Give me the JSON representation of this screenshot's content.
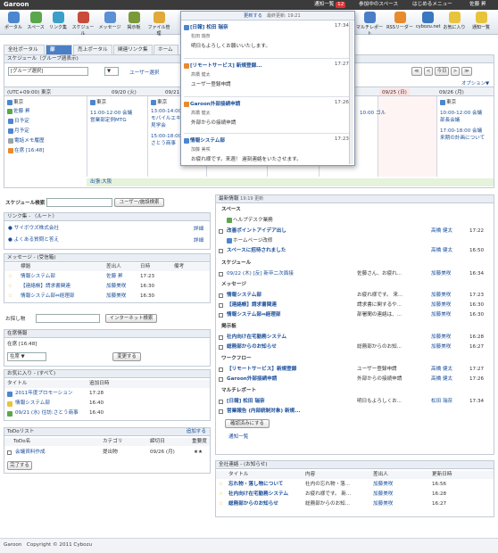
{
  "topbar": {
    "app_title": "Garoon",
    "notify_label": "通知一覧",
    "notify_count": "12",
    "space_label": "参加中のスペース",
    "beginner_menu": "はじめるメニュー",
    "user_name": "佐藤 昇"
  },
  "apps": [
    {
      "label": "ポータル",
      "icon": "portal-icon",
      "color": "#4c86cf"
    },
    {
      "label": "スペース",
      "icon": "space-icon",
      "color": "#5aa64c"
    },
    {
      "label": "リンク集",
      "icon": "link-icon",
      "color": "#3aa0c8"
    },
    {
      "label": "スケジュール",
      "icon": "calendar-icon",
      "color": "#c94b3b"
    },
    {
      "label": "メッセージ",
      "icon": "message-icon",
      "color": "#5b8fd6"
    },
    {
      "label": "掲示板",
      "icon": "bulletin-icon",
      "color": "#7a9a3a"
    },
    {
      "label": "ファイル管理",
      "icon": "folder-icon",
      "color": "#e0a93a"
    },
    {
      "label": "マルチレポート",
      "icon": "report-icon",
      "color": "#4a7fc6"
    },
    {
      "label": "RSSリーダー",
      "icon": "rss-icon",
      "color": "#e88b2c"
    },
    {
      "label": "cybozu.net",
      "icon": "cybozu-icon",
      "color": "#3a78c0"
    },
    {
      "label": "お気に入り",
      "icon": "star-icon",
      "color": "#e8c43c"
    },
    {
      "label": "通知一覧",
      "icon": "bell-icon",
      "color": "#e8c43c"
    }
  ],
  "tabs": [
    "全社ポータル",
    "部",
    "売上ポータル",
    "関連リンク集",
    "ホーム"
  ],
  "schedule": {
    "section_title": "スケジュール（グループ週表示)",
    "group_select": "[グループ選択]",
    "user_select": "ユーザー選択",
    "nav_today": "今日",
    "options": "オプション▼",
    "timezone": "(UTC+09:00) 東京",
    "days": [
      "09/20 (火)",
      "09/21 (水)",
      "",
      "",
      "",
      "09/25 (日)",
      "09/26 (月)"
    ],
    "location": "東京",
    "user_name": "佐藤 昇",
    "links": [
      "日予定",
      "月予定",
      "電話メモ履歴"
    ],
    "status": "在席 [16:48]",
    "events_tue": [
      "11:00-12:00 会議",
      "営業部定例MTG"
    ],
    "events_wed": [
      "13:00-14:00",
      "モバイルエキスポ",
      "見学会",
      "15:00-18:00",
      "さとう商事"
    ],
    "event_fri": "10:00 ゴル",
    "events_mon": [
      "10:00-12:00 会議",
      "部長会議",
      "17:00-18:00 会議",
      "来期の計画について"
    ],
    "trip": "出張:大阪"
  },
  "notify_popup": {
    "header": "更新する",
    "last_updated": "最終更新: 19:21",
    "items": [
      {
        "title": "[日報] 松田 瑞奈",
        "time": "17:34",
        "from": "松田 瑞奈",
        "body": "明日もよろしくお願いいたします。"
      },
      {
        "title": "[リモートサービス] 新規登録...",
        "time": "17:27",
        "from": "高橋 健太",
        "body": "ユーザー登録申請"
      },
      {
        "title": "Garoon外部接続申請",
        "time": "17:26",
        "from": "高橋 健太",
        "body": "外部からの接続申請"
      },
      {
        "title": "情報システム部",
        "time": "17:23",
        "from": "加藤 美咲",
        "body": "お疲れ様です。来週！ 遅刻連絡をいたさせます。"
      }
    ]
  },
  "schedule_search": {
    "title": "スケジュール検索",
    "button": "ユーザー/施設検索"
  },
  "links_panel": {
    "title": "リンク集 - 〈ルート〉",
    "items": [
      "サイボウズ株式会社",
      "よくある質問と答え"
    ],
    "detail": "詳細"
  },
  "messages_panel": {
    "title": "メッセージ - (受信箱)",
    "headers": [
      "標題",
      "差出人",
      "日時",
      "備考"
    ],
    "rows": [
      {
        "subject": "情報システム部",
        "from": "佐藤 昇",
        "time": "17:23"
      },
      {
        "subject": "【連絡帳】請求書関連",
        "from": "加藤美咲",
        "time": "16:30"
      },
      {
        "subject": "情報システム部⇔経理部",
        "from": "加藤美咲",
        "time": "16:30"
      }
    ]
  },
  "web_search": {
    "label": "お探し物",
    "button": "インターネット検索"
  },
  "presence": {
    "title": "在席情報",
    "status": "在席 [16:48]",
    "select": "在席",
    "button": "変更する"
  },
  "favorites": {
    "title": "お気に入り - (すべて)",
    "headers": [
      "タイトル",
      "追加日時"
    ],
    "rows": [
      {
        "title": "2011年度プロモーション",
        "time": "17:28"
      },
      {
        "title": "情報システム部",
        "time": "16:40"
      },
      {
        "title": "09/21 (水) 往訪:さとう商事",
        "time": "16:40"
      }
    ]
  },
  "todo": {
    "title": "ToDoリスト",
    "add": "追加する",
    "headers": [
      "ToDo名",
      "カテゴリ",
      "締切日",
      "重要度"
    ],
    "row": {
      "name": "会議資料作成",
      "category": "提出物",
      "due": "09/26 (月)",
      "priority": "★★"
    },
    "button": "完了する"
  },
  "latest": {
    "title": "最新情報",
    "updated": "19:19 更新",
    "space_h": "スペース",
    "space_sub": "ヘルプデスク業務",
    "space_items": [
      {
        "subject": "改善ポイントアイデア出し",
        "from": "高橋 健太",
        "time": "17:22"
      },
      {
        "subject": "ホームページ改修",
        "from": "",
        "time": ""
      },
      {
        "subject": "スペースに招待されました",
        "from": "高橋 健太",
        "time": "16:50"
      }
    ],
    "schedule_h": "スケジュール",
    "schedule_items": [
      {
        "subject": "09/22 (木) [反] 新卒二次面接",
        "detail": "佐藤さん、お疲れ...",
        "from": "加藤美咲",
        "time": "16:34"
      }
    ],
    "message_h": "メッセージ",
    "message_items": [
      {
        "subject": "情報システム部",
        "detail": "お疲れ様です。 来...",
        "from": "加藤美咲",
        "time": "17:23"
      },
      {
        "subject": "【連絡帳】請求書関連",
        "detail": "請求書に関するや...",
        "from": "加藤美咲",
        "time": "16:30"
      },
      {
        "subject": "情報システム部⇔経理部",
        "detail": "部署間の連絡は、...",
        "from": "加藤美咲",
        "time": "16:30"
      }
    ],
    "bulletin_h": "掲示板",
    "bulletin_items": [
      {
        "subject": "社内向け在宅勤務システム",
        "detail": "",
        "from": "加藤美咲",
        "time": "16:28"
      },
      {
        "subject": "総務部からのお知らせ",
        "detail": "総務部からのお知...",
        "from": "加藤美咲",
        "time": "16:27"
      }
    ],
    "workflow_h": "ワークフロー",
    "workflow_items": [
      {
        "subject": "【リモートサービス】新規登録",
        "detail": "ユーザー登録申請",
        "from": "高橋 健太",
        "time": "17:27"
      },
      {
        "subject": "Garoon外部接続申請",
        "detail": "外部からの接続申請",
        "from": "高橋 健太",
        "time": "17:26"
      }
    ],
    "report_h": "マルチレポート",
    "report_items": [
      {
        "subject": "[日報] 松田 瑞奈",
        "detail": "明日もよろしくお...",
        "from": "松田 瑞奈",
        "time": "17:34"
      },
      {
        "subject": "営業報告 (内部統制対象) 新規...",
        "detail": "",
        "from": "",
        "time": ""
      }
    ],
    "confirm_button": "確認済みにする",
    "notify_link": "通知一覧"
  },
  "announcements": {
    "title": "全社連絡 - (お知らせ)",
    "headers": [
      "タイトル",
      "内容",
      "差出人",
      "更新日時"
    ],
    "rows": [
      {
        "title": "忘れ物・落し物について",
        "content": "社内の忘れ物・落...",
        "from": "加藤美咲",
        "time": "16:56"
      },
      {
        "title": "社内向け在宅勤務システム",
        "content": "お疲れ様です。 新...",
        "from": "加藤美咲",
        "time": "16:28"
      },
      {
        "title": "総務部からのお知らせ",
        "content": "総務部からのお知...",
        "from": "加藤美咲",
        "time": "16:27"
      }
    ]
  },
  "footer": {
    "text": "Garoon　Copyright © 2011 Cybozu"
  }
}
